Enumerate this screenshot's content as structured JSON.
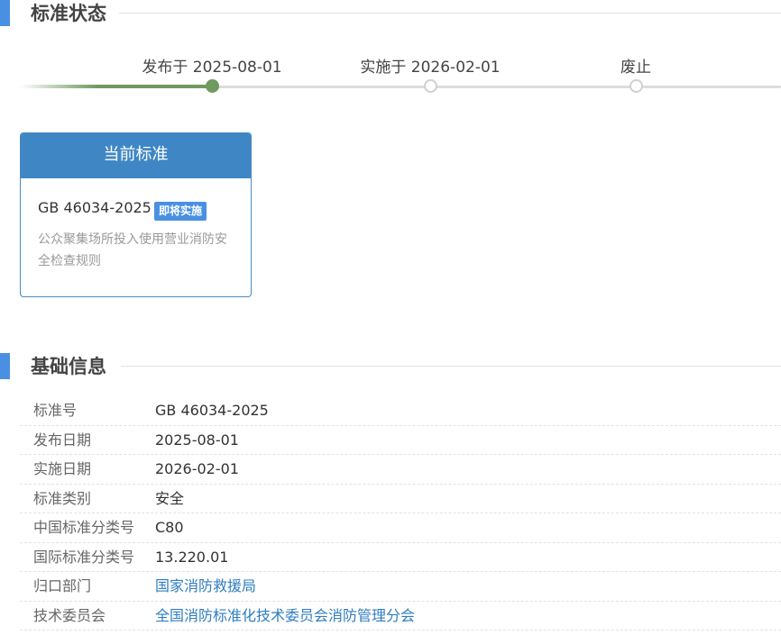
{
  "status_section": {
    "title": "标准状态",
    "steps": [
      {
        "label": "发布于 2025-08-01",
        "done": true
      },
      {
        "label": "实施于 2026-02-01",
        "done": false
      },
      {
        "label": "废止",
        "done": false
      }
    ],
    "progress": 0.25
  },
  "current_card": {
    "header": "当前标准",
    "code": "GB 46034-2025",
    "badge": "即将实施",
    "description": "公众聚集场所投入使用营业消防安全检查规则"
  },
  "info_section": {
    "title": "基础信息",
    "rows": [
      {
        "label": "标准号",
        "value": "GB 46034-2025",
        "link": false
      },
      {
        "label": "发布日期",
        "value": "2025-08-01",
        "link": false
      },
      {
        "label": "实施日期",
        "value": "2026-02-01",
        "link": false
      },
      {
        "label": "标准类别",
        "value": "安全",
        "link": false
      },
      {
        "label": "中国标准分类号",
        "value": "C80",
        "link": false
      },
      {
        "label": "国际标准分类号",
        "value": "13.220.01",
        "link": false
      },
      {
        "label": "归口部门",
        "value": "国家消防救援局",
        "link": true
      },
      {
        "label": "技术委员会",
        "value": "全国消防标准化技术委员会消防管理分会",
        "link": true
      }
    ]
  },
  "colors": {
    "accent": "#4a90e2",
    "progress": "#6f9a60",
    "card_header": "#3f87c4",
    "link": "#2f7dc0"
  }
}
